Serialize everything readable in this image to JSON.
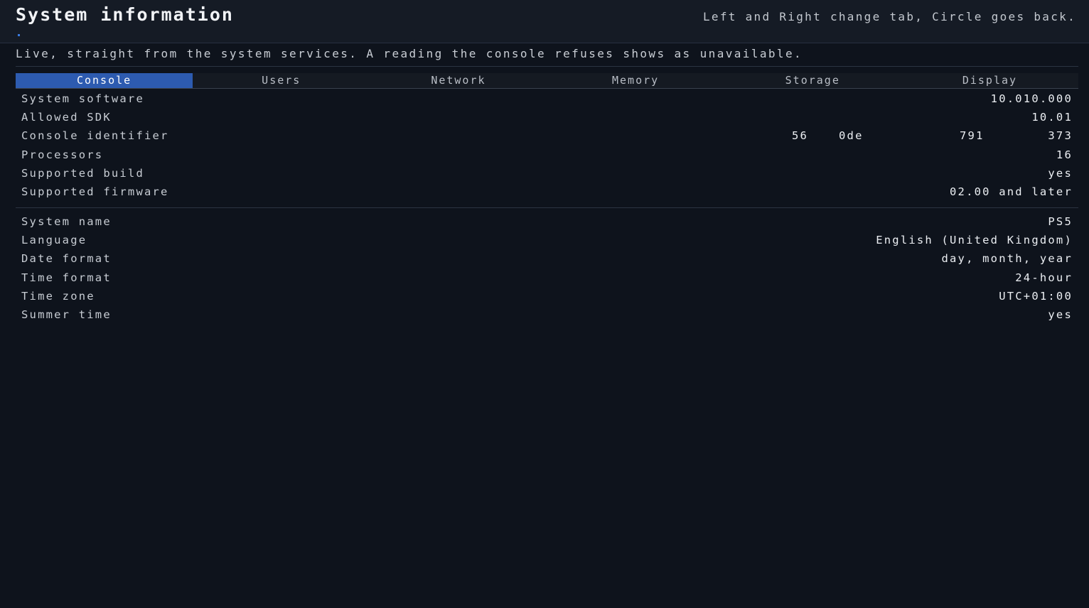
{
  "header": {
    "title": "System information",
    "hint": "Left and Right change tab, Circle goes back."
  },
  "subtitle": "Live, straight from the system services. A reading the console refuses shows as unavailable.",
  "tabs": [
    "Console",
    "Users",
    "Network",
    "Memory",
    "Storage",
    "Display"
  ],
  "active_tab": "Console",
  "console_info": [
    {
      "label": "System software",
      "value": "10.010.000"
    },
    {
      "label": "Allowed SDK",
      "value": "10.01"
    },
    {
      "label": "Console identifier",
      "segments": [
        "56",
        "0de",
        "791",
        "373"
      ]
    },
    {
      "label": "Processors",
      "value": "16"
    },
    {
      "label": "Supported build",
      "value": "yes"
    },
    {
      "label": "Supported firmware",
      "value": "02.00 and later"
    }
  ],
  "settings_info": [
    {
      "label": "System name",
      "value": "PS5"
    },
    {
      "label": "Language",
      "value": "English (United Kingdom)"
    },
    {
      "label": "Date format",
      "value": "day, month, year"
    },
    {
      "label": "Time format",
      "value": "24-hour"
    },
    {
      "label": "Time zone",
      "value": "UTC+01:00"
    },
    {
      "label": "Summer time",
      "value": "yes"
    }
  ]
}
